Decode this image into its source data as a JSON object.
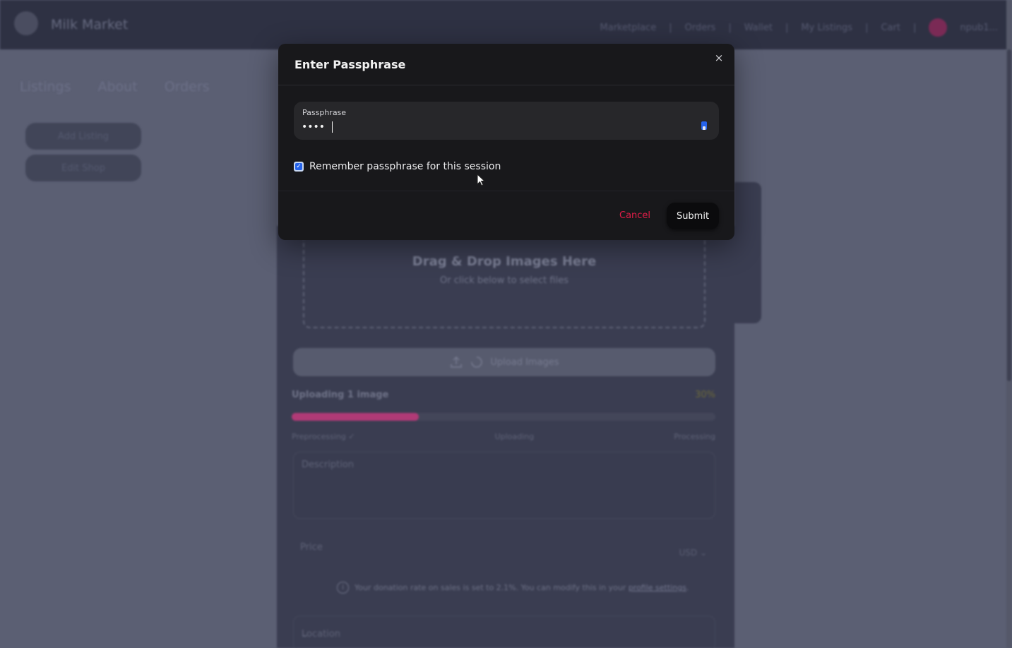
{
  "app": {
    "name": "Milk Market",
    "nav": [
      "Marketplace",
      "Orders",
      "Wallet",
      "My Listings",
      "Cart"
    ],
    "user_label": "npub1..."
  },
  "page_tabs": [
    "Listings",
    "About",
    "Orders"
  ],
  "sidebar": {
    "buttons": [
      "Add Listing",
      "Edit Shop"
    ]
  },
  "form": {
    "dropzone_title": "Drag & Drop Images Here",
    "dropzone_subtitle": "Or click below to select files",
    "upload_button": "Upload Images",
    "upload_status": "Uploading 1 image",
    "upload_percent": "30%",
    "upload_progress": 0.3,
    "stages": [
      "Preprocessing ✓",
      "Uploading",
      "Processing"
    ],
    "description_placeholder": "Description",
    "price_label": "Price",
    "currency": "USD",
    "donation_text": "Your donation rate on sales is set to 2.1%. You can modify this in your",
    "donation_link": "profile settings",
    "location_label": "Location"
  },
  "modal": {
    "title": "Enter Passphrase",
    "close_glyph": "×",
    "field_label": "Passphrase",
    "field_value": "••••",
    "remember_label": "Remember passphrase for this session",
    "remember_checked": true,
    "cancel_label": "Cancel",
    "submit_label": "Submit"
  },
  "colors": {
    "accent_pink": "#b03a76",
    "cancel_red": "#e11d48",
    "checkbox_blue": "#2563eb"
  }
}
